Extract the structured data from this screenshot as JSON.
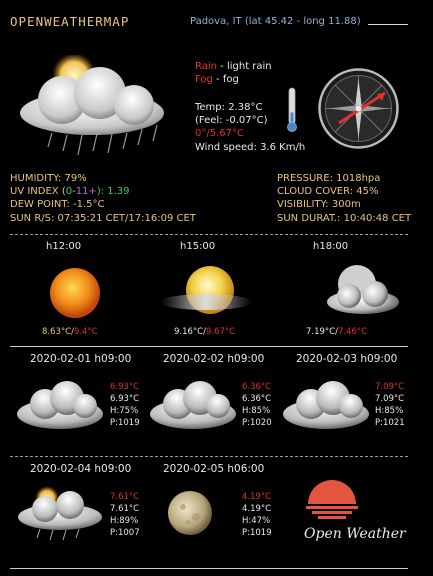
{
  "header": {
    "app_title": "OPENWEATHERMAP",
    "location": "Padova, IT  (lat 45.42 - long 11.88)"
  },
  "current": {
    "rain_key": "Rain",
    "rain_value": " - light rain",
    "fog_key": "Fog",
    "fog_value": " - fog",
    "temp": "Temp: 2.38°C",
    "feel": "(Feel: -0.07°C)",
    "minmax_min": "0°/",
    "minmax_max": "5.67°C",
    "wind": "Wind speed: 3.6 Km/h",
    "thermometer_fill": 0.35
  },
  "stats_left": {
    "humidity": "HUMIDITY: 79%",
    "uv_label": "UV INDEX (",
    "uv_range_low": "0",
    "uv_dash": "-",
    "uv_range_high": "11+",
    "uv_value": "): 1.39",
    "dew": "DEW POINT: -1.5°C",
    "sun": "SUN R/S: 07:35:21 CET/17:16:09 CET"
  },
  "stats_right": {
    "pressure": "PRESSURE: 1018hpa",
    "cloud": "CLOUD COVER: 45%",
    "visibility": "VISIBILITY: 300m",
    "sun_duration": "SUN DURAT.: 10:40:48 CET"
  },
  "hourly": [
    {
      "label": "h12:00",
      "temp": "8.63°C/",
      "temp_red": "9.4°C",
      "icon": "sun-icon"
    },
    {
      "label": "h15:00",
      "temp": "9.16°C/",
      "temp_red": "9.67°C",
      "icon": "sun-haze-icon"
    },
    {
      "label": "h18:00",
      "temp": "7.19°C/",
      "temp_red": "7.46°C",
      "icon": "moon-cloud-icon"
    }
  ],
  "daily": [
    {
      "date": "2020-02-01  h09:00",
      "red": "6.93°C",
      "t": "6.93°C",
      "h": "H:75%",
      "p": "P:1019",
      "icon": "cloud-icon"
    },
    {
      "date": "2020-02-02  h09:00",
      "red": "6.36°C",
      "t": "6.36°C",
      "h": "H:85%",
      "p": "P:1020",
      "icon": "cloud-icon"
    },
    {
      "date": "2020-02-03  h09:00",
      "red": "7.09°C",
      "t": "7.09°C",
      "h": "H:85%",
      "p": "P:1021",
      "icon": "cloud-icon"
    },
    {
      "date": "2020-02-04  h09:00",
      "red": "7.61°C",
      "t": "7.61°C",
      "h": "H:89%",
      "p": "P:1007",
      "icon": "sun-rain-cloud-icon"
    },
    {
      "date": "2020-02-05  h06:00",
      "red": "4.19°C",
      "t": "4.19°C",
      "h": "H:47%",
      "p": "P:1019",
      "icon": "moon-icon"
    }
  ],
  "logo": {
    "text": "Open Weather"
  },
  "colors": {
    "accent": "#e8c47a",
    "red": "#e0302a",
    "blue": "#8fb2d6"
  }
}
